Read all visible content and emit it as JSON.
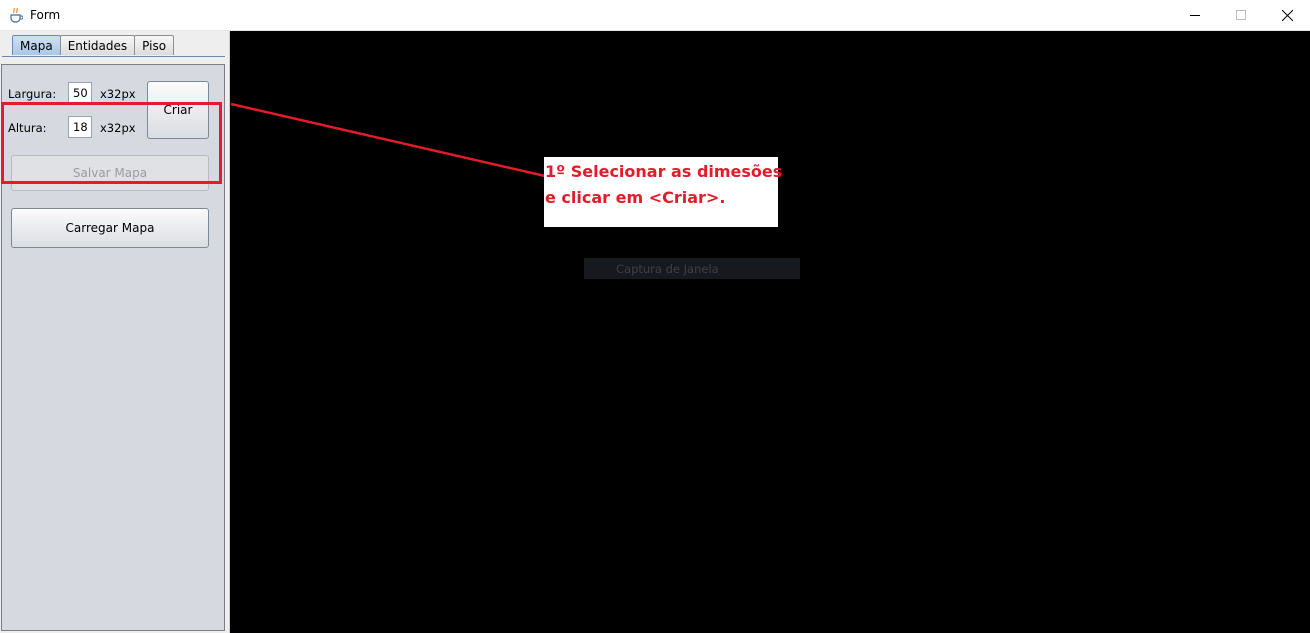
{
  "window": {
    "title": "Form",
    "icon": "java-cup-icon",
    "controls": [
      "minimize-icon",
      "maximize-icon",
      "close-icon"
    ]
  },
  "tabs": [
    {
      "label": "Mapa",
      "active": true
    },
    {
      "label": "Entidades",
      "active": false
    },
    {
      "label": "Piso",
      "active": false
    }
  ],
  "map_form": {
    "width_label": "Largura:",
    "width_value": "50",
    "width_unit": "x32px",
    "height_label": "Altura:",
    "height_value": "18",
    "height_unit": "x32px",
    "create_button": "Criar",
    "save_button": "Salvar Mapa",
    "save_enabled": false,
    "load_button": "Carregar Mapa"
  },
  "annotation": {
    "line1": "1º Selecionar as dimesões",
    "line2": "e clicar em <Criar>.",
    "color": "#e21c2a"
  },
  "overlay": {
    "capture_label": "Captura de Janela"
  }
}
